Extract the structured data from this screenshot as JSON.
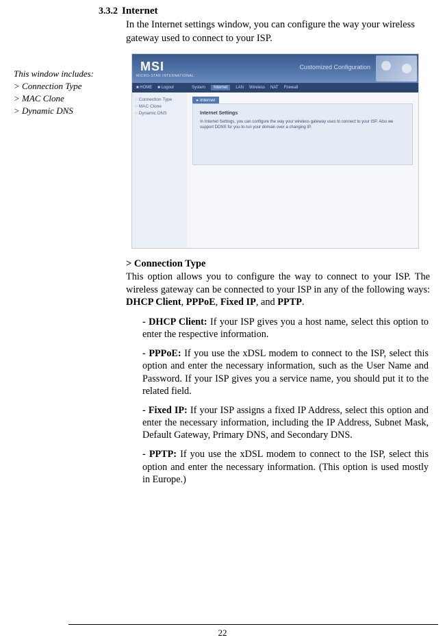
{
  "section": {
    "number": "3.3.2",
    "title": "Internet",
    "intro": "In the Internet settings window, you can configure the way your wireless gateway used to connect to your ISP."
  },
  "sidebar": {
    "heading": "This window includes:",
    "items": [
      "> Connection Type",
      "> MAC Clone",
      "> Dynamic DNS"
    ]
  },
  "ui": {
    "logo": "MSI",
    "logo_sub": "MICRO-STAR INTERNATIONAL",
    "headline": "Customized Configuration",
    "nav": {
      "home": "HOME",
      "logout": "Logout",
      "items": [
        "System",
        "Internet",
        "LAN",
        "Wireless",
        "NAT",
        "Firewall"
      ],
      "active": "Internet"
    },
    "side_items": [
      "Connection Type",
      "MAC Clone",
      "Dynamic DNS"
    ],
    "tab": "Internet",
    "panel_title": "Internet Settings",
    "panel_text": "In Internet Settings, you can configure the way your wireless gateway uses to connect to your ISP. Also we support DDNS for you to run your domain over a changing IP."
  },
  "connection_type": {
    "heading": "> Connection Type",
    "para": "This option allows you to configure the way to connect to your ISP.  The wireless gateway can be connected to your ISP in any of the following ways: ",
    "bold_list": [
      "DHCP Client",
      "PPPoE",
      "Fixed IP",
      "PPTP"
    ],
    "and": ", and",
    "sep": ", ",
    "dhcp_label": "- DHCP Client:",
    "dhcp_text": " If your ISP gives you a host name, select this option to enter the respective information.",
    "pppoe_label": "- PPPoE:",
    "pppoe_text": " If you use the xDSL modem to connect to the ISP, select this option and enter the necessary informa­tion, such as the User Name and Password.  If your ISP gives you a service name, you should put it to the related field.",
    "fixedip_label": "- Fixed IP:",
    "fixedip_text": " If your ISP assigns a fixed IP Address, select this option and enter the necessary information, includ­ing the IP Address, Subnet Mask, Default Gateway, Pri­mary DNS, and Secondary DNS.",
    "pptp_label": "- PPTP:",
    "pptp_text": " If you use the xDSL modem to connect to the ISP, select this option and enter the necessary informa­tion.  (This option is used mostly in Europe.)"
  },
  "page_number": "22"
}
